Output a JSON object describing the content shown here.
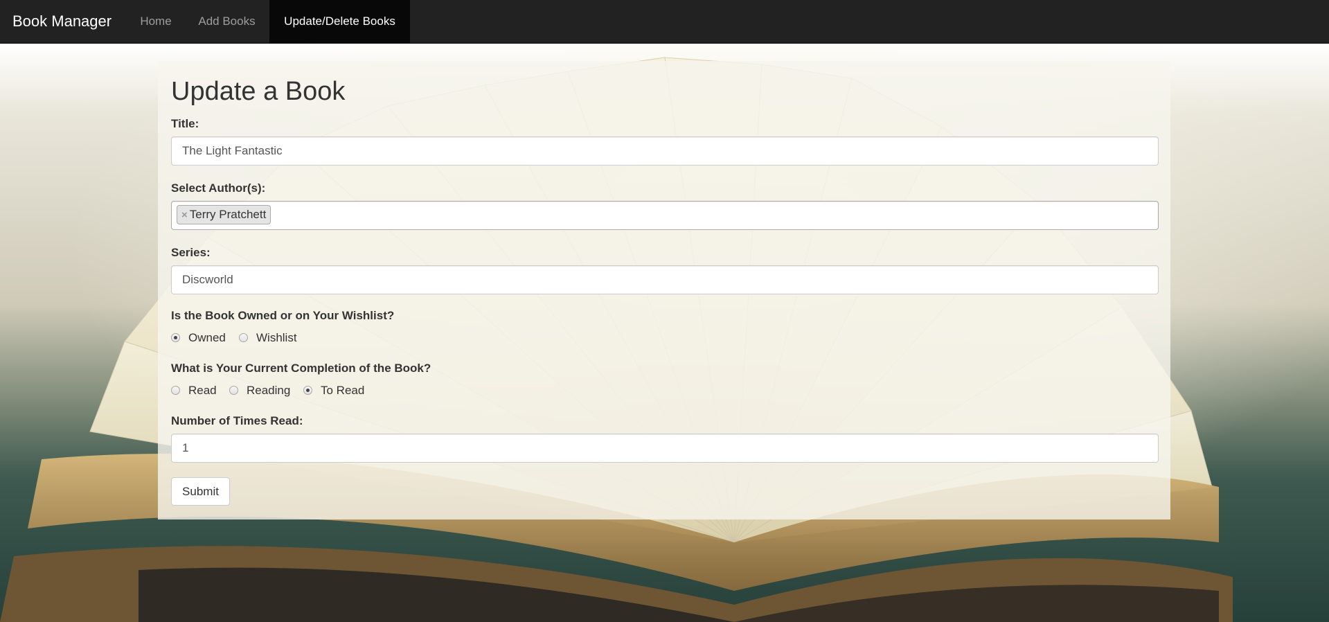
{
  "navbar": {
    "brand": "Book Manager",
    "links": [
      {
        "label": "Home",
        "active": false
      },
      {
        "label": "Add Books",
        "active": false
      },
      {
        "label": "Update/Delete Books",
        "active": true
      }
    ]
  },
  "form": {
    "heading": "Update a Book",
    "title_label": "Title:",
    "title_value": "The Light Fantastic",
    "authors_label": "Select Author(s):",
    "authors": [
      {
        "remove_glyph": "×",
        "name": "Terry Pratchett"
      }
    ],
    "series_label": "Series:",
    "series_value": "Discworld",
    "ownership_label": "Is the Book Owned or on Your Wishlist?",
    "ownership_options": [
      {
        "label": "Owned",
        "checked": true
      },
      {
        "label": "Wishlist",
        "checked": false
      }
    ],
    "completion_label": "What is Your Current Completion of the Book?",
    "completion_options": [
      {
        "label": "Read",
        "checked": false
      },
      {
        "label": "Reading",
        "checked": false
      },
      {
        "label": "To Read",
        "checked": true
      }
    ],
    "times_read_label": "Number of Times Read:",
    "times_read_value": "1",
    "submit_label": "Submit"
  },
  "colors": {
    "navbar_bg": "#222222",
    "navbar_active_bg": "#080808",
    "panel_bg": "rgba(246,245,238,0.80)"
  }
}
